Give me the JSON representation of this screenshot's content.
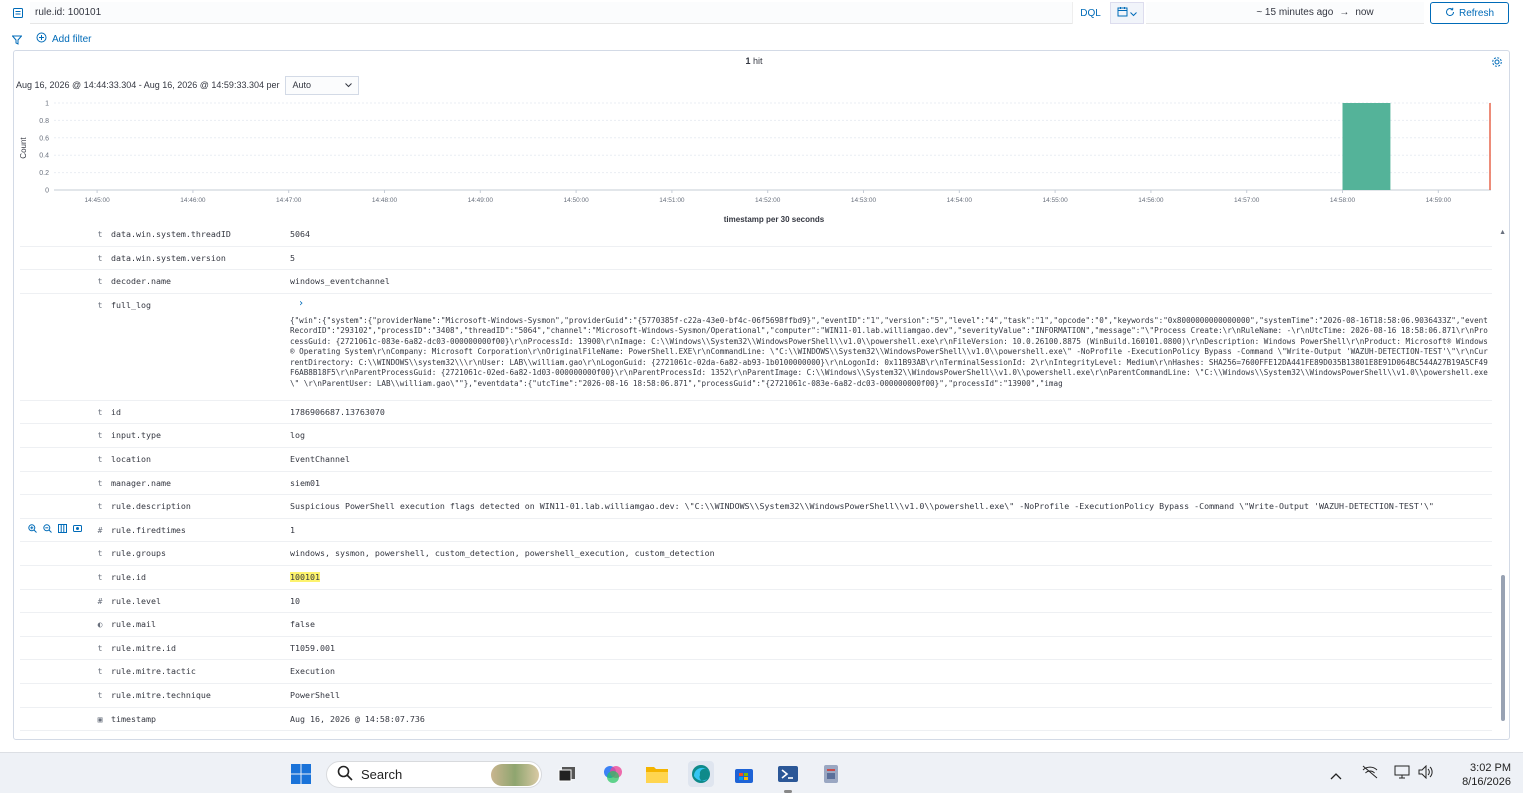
{
  "query": {
    "value": "rule.id: 100101",
    "language": "DQL"
  },
  "time": {
    "range": "~ 15 minutes ago",
    "arrow": "→",
    "end": "now",
    "refresh_label": "Refresh"
  },
  "filter": {
    "add_label": "Add filter"
  },
  "results": {
    "hits_count": "1",
    "hits_label": "hit",
    "interval_text": "Aug 16, 2026 @ 14:44:33.304 - Aug 16, 2026 @ 14:59:33.304 per",
    "interval_value": "Auto"
  },
  "chart_data": {
    "type": "bar",
    "ylabel": "Count",
    "xlabel": "timestamp per 30 seconds",
    "ylim": [
      0,
      1
    ],
    "yticks": [
      "0",
      "0.2",
      "0.4",
      "0.6",
      "0.8",
      "1"
    ],
    "xticks": [
      "14:45:00",
      "14:46:00",
      "14:47:00",
      "14:48:00",
      "14:49:00",
      "14:50:00",
      "14:51:00",
      "14:52:00",
      "14:53:00",
      "14:54:00",
      "14:55:00",
      "14:56:00",
      "14:57:00",
      "14:58:00",
      "14:59:00"
    ],
    "bars": [
      {
        "x": "14:58:00",
        "value": 1
      }
    ],
    "bar_color": "#54b399",
    "now_marker_color": "#e7664c"
  },
  "fields": [
    {
      "type": "t",
      "name": "data.win.system.threadID",
      "value": "5064"
    },
    {
      "type": "t",
      "name": "data.win.system.version",
      "value": "5"
    },
    {
      "type": "t",
      "name": "decoder.name",
      "value": "windows_eventchannel"
    },
    {
      "type": "t",
      "name": "full_log",
      "value": "{\"win\":{\"system\":{\"providerName\":\"Microsoft-Windows-Sysmon\",\"providerGuid\":\"{5770385f-c22a-43e0-bf4c-06f5698ffbd9}\",\"eventID\":\"1\",\"version\":\"5\",\"level\":\"4\",\"task\":\"1\",\"opcode\":\"0\",\"keywords\":\"0x8000000000000000\",\"systemTime\":\"2026-08-16T18:58:06.9036433Z\",\"eventRecordID\":\"293102\",\"processID\":\"3408\",\"threadID\":\"5064\",\"channel\":\"Microsoft-Windows-Sysmon/Operational\",\"computer\":\"WIN11-01.lab.williamgao.dev\",\"severityValue\":\"INFORMATION\",\"message\":\"\\\"Process Create:\\r\\nRuleName: -\\r\\nUtcTime: 2026-08-16 18:58:06.871\\r\\nProcessGuid: {2721061c-083e-6a82-dc03-000000000f00}\\r\\nProcessId: 13900\\r\\nImage: C:\\\\Windows\\\\System32\\\\WindowsPowerShell\\\\v1.0\\\\powershell.exe\\r\\nFileVersion: 10.0.26100.8875 (WinBuild.160101.0800)\\r\\nDescription: Windows PowerShell\\r\\nProduct: Microsoft® Windows® Operating System\\r\\nCompany: Microsoft Corporation\\r\\nOriginalFileName: PowerShell.EXE\\r\\nCommandLine: \\\"C:\\\\WINDOWS\\\\System32\\\\WindowsPowerShell\\\\v1.0\\\\powershell.exe\\\" -NoProfile -ExecutionPolicy Bypass -Command \\\"Write-Output 'WAZUH-DETECTION-TEST'\\\"\\r\\nCurrentDirectory: C:\\\\WINDOWS\\\\system32\\\\\\r\\nUser: LAB\\\\william.gao\\r\\nLogonGuid: {2721061c-02da-6a82-ab93-1b0100000000}\\r\\nLogonId: 0x11B93AB\\r\\nTerminalSessionId: 2\\r\\nIntegrityLevel: Medium\\r\\nHashes: SHA256=7600FFE12DA441FE89D035B13801E8E91D064BC544A27B19A5CF49F6AB8B18F5\\r\\nParentProcessGuid: {2721061c-02ed-6a82-1d03-000000000f00}\\r\\nParentProcessId: 1352\\r\\nParentImage: C:\\\\Windows\\\\System32\\\\WindowsPowerShell\\\\v1.0\\\\powershell.exe\\r\\nParentCommandLine: \\\"C:\\\\Windows\\\\System32\\\\WindowsPowerShell\\\\v1.0\\\\powershell.exe\\\" \\r\\nParentUser: LAB\\\\william.gao\\\"\"},\"eventdata\":{\"utcTime\":\"2026-08-16 18:58:06.871\",\"processGuid\":\"{2721061c-083e-6a82-dc03-000000000f00}\",\"processId\":\"13900\",\"imag"
    },
    {
      "type": "t",
      "name": "id",
      "value": "1786906687.13763070"
    },
    {
      "type": "t",
      "name": "input.type",
      "value": "log"
    },
    {
      "type": "t",
      "name": "location",
      "value": "EventChannel"
    },
    {
      "type": "t",
      "name": "manager.name",
      "value": "siem01"
    },
    {
      "type": "t",
      "name": "rule.description",
      "value": "Suspicious PowerShell execution flags detected on WIN11-01.lab.williamgao.dev: \\\"C:\\\\WINDOWS\\\\System32\\\\WindowsPowerShell\\\\v1.0\\\\powershell.exe\\\" -NoProfile -ExecutionPolicy Bypass -Command \\\"Write-Output 'WAZUH-DETECTION-TEST'\\\""
    },
    {
      "type": "#",
      "name": "rule.firedtimes",
      "value": "1"
    },
    {
      "type": "t",
      "name": "rule.groups",
      "value": "windows, sysmon, powershell, custom_detection, powershell_execution, custom_detection"
    },
    {
      "type": "t",
      "name": "rule.id",
      "value": "100101"
    },
    {
      "type": "#",
      "name": "rule.level",
      "value": "10"
    },
    {
      "type": "◐",
      "name": "rule.mail",
      "value": "false"
    },
    {
      "type": "t",
      "name": "rule.mitre.id",
      "value": "T1059.001"
    },
    {
      "type": "t",
      "name": "rule.mitre.tactic",
      "value": "Execution"
    },
    {
      "type": "t",
      "name": "rule.mitre.technique",
      "value": "PowerShell"
    },
    {
      "type": "▣",
      "name": "timestamp",
      "value": "Aug 16, 2026 @ 14:58:07.736"
    }
  ],
  "taskbar": {
    "search_label": "Search",
    "time": "3:02 PM",
    "date": "8/16/2026"
  }
}
